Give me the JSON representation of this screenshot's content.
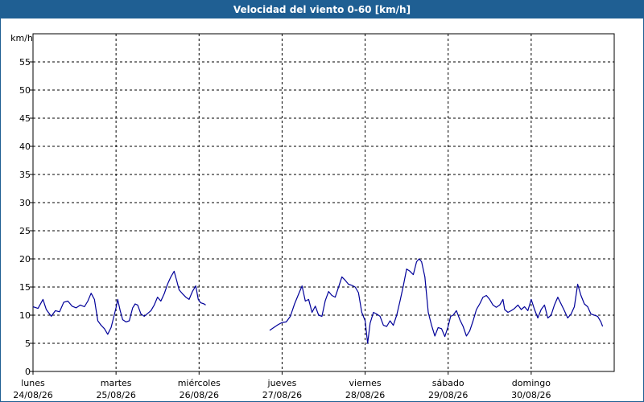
{
  "window": {
    "title": "Velocidad del viento 0-60 [km/h]"
  },
  "chart_data": {
    "type": "line",
    "title": "Velocidad del viento 0-60 [km/h]",
    "ylabel": "km/h",
    "ylim": [
      0,
      60
    ],
    "yticks": [
      0,
      5,
      10,
      15,
      20,
      25,
      30,
      35,
      40,
      45,
      50,
      55
    ],
    "x_unit": "days from 24/08/26 00:00",
    "xlim": [
      0,
      7
    ],
    "grid": true,
    "days": [
      {
        "day": "lunes",
        "date": "24/08/26"
      },
      {
        "day": "martes",
        "date": "25/08/26"
      },
      {
        "day": "miércoles",
        "date": "26/08/26"
      },
      {
        "day": "jueves",
        "date": "27/08/26"
      },
      {
        "day": "viernes",
        "date": "28/08/26"
      },
      {
        "day": "sábado",
        "date": "29/08/26"
      },
      {
        "day": "domingo",
        "date": "30/08/26"
      }
    ],
    "colors": {
      "line": "#000099",
      "grid": "#000000",
      "title_bar": "#1f5f93"
    },
    "series": [
      {
        "segments": [
          [
            [
              0.0,
              11.5
            ],
            [
              0.06,
              11.2
            ],
            [
              0.12,
              12.8
            ],
            [
              0.16,
              11.0
            ],
            [
              0.22,
              9.8
            ],
            [
              0.27,
              10.8
            ],
            [
              0.32,
              10.6
            ],
            [
              0.37,
              12.3
            ],
            [
              0.42,
              12.5
            ],
            [
              0.47,
              11.6
            ],
            [
              0.52,
              11.3
            ],
            [
              0.57,
              11.8
            ],
            [
              0.62,
              11.5
            ],
            [
              0.66,
              12.5
            ],
            [
              0.7,
              13.9
            ],
            [
              0.74,
              12.8
            ],
            [
              0.78,
              9.0
            ],
            [
              0.82,
              8.2
            ],
            [
              0.86,
              7.6
            ],
            [
              0.9,
              6.6
            ],
            [
              0.94,
              7.8
            ],
            [
              0.97,
              9.5
            ],
            [
              1.0,
              11.3
            ],
            [
              1.02,
              12.8
            ],
            [
              1.05,
              10.8
            ],
            [
              1.08,
              9.2
            ],
            [
              1.12,
              8.8
            ],
            [
              1.16,
              9.0
            ],
            [
              1.2,
              11.3
            ],
            [
              1.23,
              12.0
            ],
            [
              1.26,
              11.8
            ],
            [
              1.3,
              10.2
            ],
            [
              1.34,
              9.8
            ],
            [
              1.38,
              10.3
            ],
            [
              1.42,
              10.8
            ],
            [
              1.46,
              11.8
            ],
            [
              1.5,
              13.2
            ],
            [
              1.54,
              12.5
            ],
            [
              1.58,
              13.8
            ],
            [
              1.62,
              15.5
            ],
            [
              1.66,
              16.8
            ],
            [
              1.7,
              17.8
            ],
            [
              1.73,
              16.2
            ],
            [
              1.76,
              14.5
            ],
            [
              1.8,
              13.8
            ],
            [
              1.84,
              13.2
            ],
            [
              1.88,
              12.8
            ],
            [
              1.92,
              14.2
            ],
            [
              1.96,
              15.2
            ],
            [
              1.99,
              12.8
            ],
            [
              2.02,
              12.2
            ],
            [
              2.06,
              12.0
            ],
            [
              2.08,
              11.8
            ]
          ],
          [
            [
              2.85,
              7.3
            ],
            [
              2.9,
              7.8
            ],
            [
              2.95,
              8.3
            ],
            [
              3.0,
              8.7
            ],
            [
              3.05,
              8.8
            ],
            [
              3.1,
              9.8
            ],
            [
              3.15,
              12.0
            ],
            [
              3.2,
              13.8
            ],
            [
              3.24,
              15.2
            ],
            [
              3.28,
              12.5
            ],
            [
              3.32,
              12.8
            ],
            [
              3.36,
              10.5
            ],
            [
              3.4,
              11.6
            ],
            [
              3.44,
              10.0
            ],
            [
              3.48,
              9.8
            ],
            [
              3.52,
              12.6
            ],
            [
              3.56,
              14.2
            ],
            [
              3.6,
              13.5
            ],
            [
              3.64,
              13.2
            ],
            [
              3.68,
              15.0
            ],
            [
              3.72,
              16.8
            ],
            [
              3.76,
              16.2
            ],
            [
              3.8,
              15.5
            ],
            [
              3.84,
              15.3
            ],
            [
              3.88,
              15.0
            ],
            [
              3.92,
              14.0
            ],
            [
              3.96,
              10.5
            ],
            [
              4.0,
              9.0
            ],
            [
              4.03,
              5.0
            ],
            [
              4.06,
              8.6
            ],
            [
              4.1,
              10.5
            ],
            [
              4.14,
              10.2
            ],
            [
              4.18,
              9.8
            ],
            [
              4.22,
              8.2
            ],
            [
              4.26,
              8.0
            ],
            [
              4.3,
              9.0
            ],
            [
              4.34,
              8.2
            ],
            [
              4.38,
              10.0
            ],
            [
              4.42,
              12.5
            ],
            [
              4.46,
              15.2
            ],
            [
              4.5,
              18.2
            ],
            [
              4.54,
              17.8
            ],
            [
              4.58,
              17.2
            ],
            [
              4.62,
              19.5
            ],
            [
              4.65,
              20.0
            ],
            [
              4.68,
              19.5
            ],
            [
              4.72,
              16.8
            ],
            [
              4.76,
              10.5
            ],
            [
              4.8,
              8.2
            ],
            [
              4.84,
              6.3
            ],
            [
              4.88,
              7.8
            ],
            [
              4.92,
              7.6
            ],
            [
              4.96,
              6.2
            ],
            [
              5.0,
              8.0
            ],
            [
              5.03,
              9.8
            ],
            [
              5.06,
              10.0
            ],
            [
              5.1,
              10.8
            ],
            [
              5.14,
              9.2
            ],
            [
              5.18,
              8.0
            ],
            [
              5.22,
              6.3
            ],
            [
              5.26,
              7.2
            ],
            [
              5.3,
              9.0
            ],
            [
              5.34,
              11.0
            ],
            [
              5.38,
              12.0
            ],
            [
              5.42,
              13.2
            ],
            [
              5.46,
              13.5
            ],
            [
              5.5,
              12.8
            ],
            [
              5.54,
              11.8
            ],
            [
              5.58,
              11.4
            ],
            [
              5.62,
              11.8
            ],
            [
              5.66,
              12.8
            ],
            [
              5.68,
              11.0
            ],
            [
              5.72,
              10.5
            ],
            [
              5.76,
              10.8
            ],
            [
              5.8,
              11.2
            ],
            [
              5.84,
              11.8
            ],
            [
              5.88,
              11.0
            ],
            [
              5.92,
              11.5
            ],
            [
              5.96,
              10.8
            ],
            [
              6.0,
              12.8
            ],
            [
              6.04,
              11.0
            ],
            [
              6.08,
              9.5
            ],
            [
              6.12,
              11.0
            ],
            [
              6.16,
              11.8
            ],
            [
              6.2,
              9.5
            ],
            [
              6.24,
              10.0
            ],
            [
              6.28,
              11.8
            ],
            [
              6.32,
              13.2
            ],
            [
              6.36,
              12.0
            ],
            [
              6.4,
              10.8
            ],
            [
              6.44,
              9.5
            ],
            [
              6.48,
              10.2
            ],
            [
              6.52,
              11.5
            ],
            [
              6.56,
              15.5
            ],
            [
              6.6,
              13.5
            ],
            [
              6.64,
              12.0
            ],
            [
              6.68,
              11.5
            ],
            [
              6.72,
              10.2
            ],
            [
              6.76,
              10.0
            ],
            [
              6.8,
              9.8
            ],
            [
              6.84,
              8.8
            ],
            [
              6.86,
              8.0
            ]
          ]
        ]
      }
    ]
  }
}
